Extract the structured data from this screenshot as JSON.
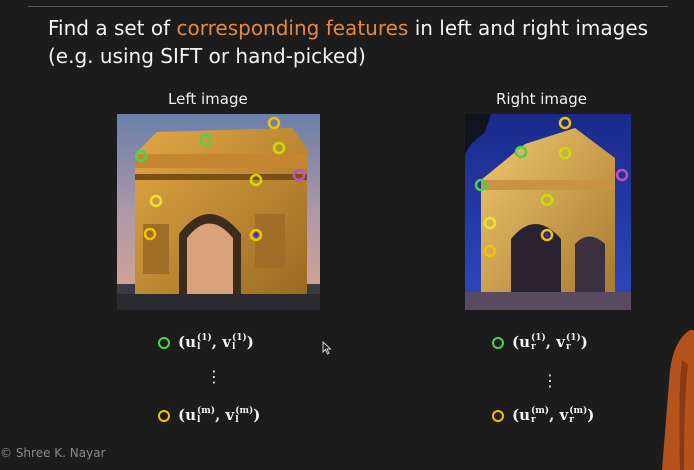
{
  "slide": {
    "title_pre": "Find a set of ",
    "title_highlight": "corresponding features",
    "title_post": " in left and right images",
    "title_line2": "(e.g. using SIFT or hand-picked)",
    "highlight_color": "#e7883f",
    "background_color": "#1c1c1c"
  },
  "left": {
    "label": "Left image",
    "first_feature": {
      "u": "u",
      "v": "v",
      "sub": "l",
      "sup": "(1)",
      "color": "#3fbf3f"
    },
    "last_feature": {
      "u": "u",
      "v": "v",
      "sub": "l",
      "sup": "(m)",
      "color": "#e8c23a"
    },
    "vdots": "⋮"
  },
  "right": {
    "label": "Right image",
    "first_feature": {
      "u": "u",
      "v": "v",
      "sub": "r",
      "sup": "(1)",
      "color": "#3fbf3f"
    },
    "last_feature": {
      "u": "u",
      "v": "v",
      "sub": "r",
      "sup": "(m)",
      "color": "#e8c23a"
    },
    "vdots": "⋮"
  },
  "footer": {
    "credit": "© Shree K. Nayar"
  },
  "icons": {
    "cursor": "mouse-pointer-icon"
  }
}
